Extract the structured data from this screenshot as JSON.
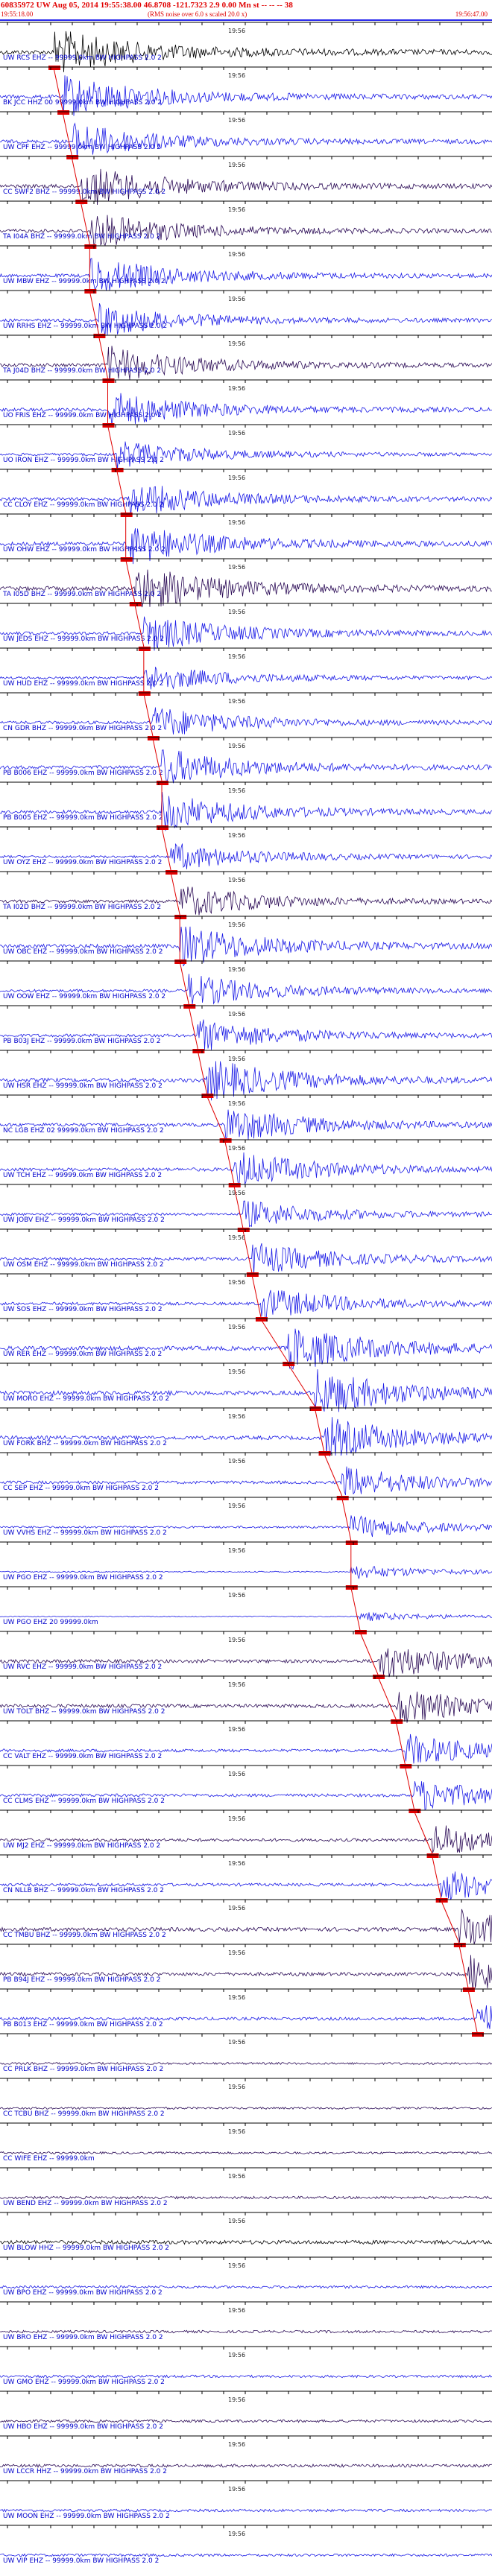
{
  "header": {
    "title": "60835972 UW Aug 05, 2014 19:55:38.00    46.8708 -121.7323  2.9 0.00 Mn st -- -- -- 38",
    "start_time": "19:55:18.00",
    "rms_note": "(RMS noise over 6.0 s scaled 20.0 x)",
    "end_time": "19:56:47.00"
  },
  "colors": {
    "title": "#e00000",
    "trace_blue": "#1a1ae6",
    "trace_dark": "#2a0a55",
    "trace_black": "#000000",
    "pick_red": "#e00000",
    "tick": "#000000"
  },
  "chart_data": {
    "type": "line",
    "title": "60835972 UW Aug 05, 2014 19:55:38.00    46.8708 -121.7323  2.9 0.00 Mn st -- -- -- 38",
    "time_range": [
      "19:55:18.00",
      "19:56:47.00"
    ],
    "tick_label": "19:56",
    "series": [
      {
        "name": "UW RCS EHZ -- 99999.0km BW HIGHPASS 2.0 2",
        "pick": 0.0,
        "amp": 1.0,
        "color": "black"
      },
      {
        "name": "BK JCC HHZ 00 99999.0km BW HIGHPASS 2.0 2",
        "pick": 0.01,
        "amp": 0.9,
        "color": "blue"
      },
      {
        "name": "UW CPF EHZ -- 99999.0km BW HIGHPASS 2.0 2",
        "pick": 0.02,
        "amp": 0.8,
        "color": "blue"
      },
      {
        "name": "CC SWF2 BHZ -- 99999.0km BW HIGHPASS 2.0 2",
        "pick": 0.03,
        "amp": 0.9,
        "color": "dark"
      },
      {
        "name": "TA I04A BHZ -- 99999.0km BW HIGHPASS 2.0 2",
        "pick": 0.04,
        "amp": 0.8,
        "color": "dark"
      },
      {
        "name": "UW MBW EHZ -- 99999.0km BW HIGHPASS 2.0 2",
        "pick": 0.04,
        "amp": 0.8,
        "color": "blue"
      },
      {
        "name": "UW RRHS EHZ -- 99999.0km BW HIGHPASS 2.0 2",
        "pick": 0.05,
        "amp": 0.7,
        "color": "blue"
      },
      {
        "name": "TA J04D BHZ -- 99999.0km BW HIGHPASS 2.0 2",
        "pick": 0.06,
        "amp": 0.8,
        "color": "dark"
      },
      {
        "name": "UO FRIS EHZ -- 99999.0km BW HIGHPASS 2.0 2",
        "pick": 0.06,
        "amp": 0.8,
        "color": "blue"
      },
      {
        "name": "UO IRON EHZ -- 99999.0km BW HIGHPASS 2.0 2",
        "pick": 0.07,
        "amp": 0.6,
        "color": "blue"
      },
      {
        "name": "CC CLOY EHZ -- 99999.0km BW HIGHPASS 2.0 2",
        "pick": 0.08,
        "amp": 0.8,
        "color": "blue"
      },
      {
        "name": "UW OHW EHZ -- 99999.0km BW HIGHPASS 2.0 2",
        "pick": 0.08,
        "amp": 0.9,
        "color": "blue"
      },
      {
        "name": "TA I05D BHZ -- 99999.0km BW HIGHPASS 2.0 2",
        "pick": 0.09,
        "amp": 1.0,
        "color": "dark"
      },
      {
        "name": "UW JEDS EHZ -- 99999.0km BW HIGHPASS 2.0 2",
        "pick": 0.1,
        "amp": 0.8,
        "color": "blue"
      },
      {
        "name": "UW HUD EHZ -- 99999.0km BW HIGHPASS 2.0 2",
        "pick": 0.1,
        "amp": 0.6,
        "color": "blue"
      },
      {
        "name": "CN GDR BHZ -- 99999.0km BW HIGHPASS 2.0 2",
        "pick": 0.11,
        "amp": 0.7,
        "color": "blue"
      },
      {
        "name": "PB B006 EHZ -- 99999.0km BW HIGHPASS 2.0 2",
        "pick": 0.12,
        "amp": 0.8,
        "color": "blue"
      },
      {
        "name": "PB B005 EHZ -- 99999.0km BW HIGHPASS 2.0 2",
        "pick": 0.12,
        "amp": 0.8,
        "color": "blue"
      },
      {
        "name": "UW OYZ EHZ -- 99999.0km BW HIGHPASS 2.0 2",
        "pick": 0.13,
        "amp": 0.6,
        "color": "blue"
      },
      {
        "name": "TA I02D BHZ -- 99999.0km BW HIGHPASS 2.0 2",
        "pick": 0.14,
        "amp": 0.7,
        "color": "dark"
      },
      {
        "name": "UW OBC EHZ -- 99999.0km BW HIGHPASS 2.0 2",
        "pick": 0.14,
        "amp": 0.9,
        "color": "blue"
      },
      {
        "name": "UW OOW EHZ -- 99999.0km BW HIGHPASS 2.0 2",
        "pick": 0.15,
        "amp": 0.7,
        "color": "blue"
      },
      {
        "name": "PB B03J EHZ -- 99999.0km BW HIGHPASS 2.0 2",
        "pick": 0.16,
        "amp": 0.7,
        "color": "blue"
      },
      {
        "name": "UW HSR EHZ -- 99999.0km BW HIGHPASS 2.0 2",
        "pick": 0.17,
        "amp": 0.9,
        "color": "blue"
      },
      {
        "name": "NC LGB EHZ 02 99999.0km BW HIGHPASS 2.0 2",
        "pick": 0.19,
        "amp": 0.8,
        "color": "blue"
      },
      {
        "name": "UW TCH EHZ -- 99999.0km BW HIGHPASS 2.0 2",
        "pick": 0.2,
        "amp": 0.8,
        "color": "blue"
      },
      {
        "name": "UW JOBV EHZ -- 99999.0km BW HIGHPASS 2.0 2",
        "pick": 0.21,
        "amp": 0.6,
        "color": "blue"
      },
      {
        "name": "UW OSM EHZ -- 99999.0km BW HIGHPASS 2.0 2",
        "pick": 0.22,
        "amp": 0.7,
        "color": "blue"
      },
      {
        "name": "UW SOS EHZ -- 99999.0km BW HIGHPASS 2.0 2",
        "pick": 0.23,
        "amp": 0.7,
        "color": "blue"
      },
      {
        "name": "UW RER EHZ -- 99999.0km BW HIGHPASS 2.0 2",
        "pick": 0.26,
        "amp": 1.0,
        "color": "blue"
      },
      {
        "name": "UW MORO EHZ -- 99999.0km BW HIGHPASS 2.0 2",
        "pick": 0.29,
        "amp": 1.0,
        "color": "blue"
      },
      {
        "name": "UW FORK BHZ -- 99999.0km BW HIGHPASS 2.0 2",
        "pick": 0.3,
        "amp": 0.9,
        "color": "blue"
      },
      {
        "name": "CC SEP EHZ -- 99999.0km BW HIGHPASS 2.0 2",
        "pick": 0.32,
        "amp": 0.7,
        "color": "blue"
      },
      {
        "name": "UW VVHS EHZ -- 99999.0km BW HIGHPASS 2.0 2",
        "pick": 0.33,
        "amp": 0.5,
        "color": "blue"
      },
      {
        "name": "UW PGO EHZ -- 99999.0km BW HIGHPASS 2.0 2",
        "pick": 0.33,
        "amp": 0.3,
        "color": "blue"
      },
      {
        "name": "UW PGO EHZ 20 99999.0km",
        "pick": 0.34,
        "amp": 0.2,
        "color": "blue"
      },
      {
        "name": "UW RVC EHZ -- 99999.0km BW HIGHPASS 2.0 2",
        "pick": 0.36,
        "amp": 0.8,
        "color": "dark"
      },
      {
        "name": "UW TOLT BHZ -- 99999.0km BW HIGHPASS 2.0 2",
        "pick": 0.38,
        "amp": 0.8,
        "color": "dark"
      },
      {
        "name": "CC VALT EHZ -- 99999.0km BW HIGHPASS 2.0 2",
        "pick": 0.39,
        "amp": 0.7,
        "color": "blue"
      },
      {
        "name": "CC CLMS EHZ -- 99999.0km BW HIGHPASS 2.0 2",
        "pick": 0.4,
        "amp": 0.7,
        "color": "blue"
      },
      {
        "name": "UW MJ2 EHZ -- 99999.0km BW HIGHPASS 2.0 2",
        "pick": 0.42,
        "amp": 0.7,
        "color": "dark"
      },
      {
        "name": "CN NLLB BHZ -- 99999.0km BW HIGHPASS 2.0 2",
        "pick": 0.43,
        "amp": 0.7,
        "color": "blue"
      },
      {
        "name": "CC TMBU BHZ -- 99999.0km BW HIGHPASS 2.0 2",
        "pick": 0.45,
        "amp": 0.9,
        "color": "dark"
      },
      {
        "name": "PB B94J EHZ -- 99999.0km BW HIGHPASS 2.0 2",
        "pick": 0.46,
        "amp": 0.8,
        "color": "dark"
      },
      {
        "name": "PB B013 EHZ -- 99999.0km BW HIGHPASS 2.0 2",
        "pick": 0.47,
        "amp": 0.7,
        "color": "blue"
      },
      {
        "name": "CC PRLK BHZ -- 99999.0km BW HIGHPASS 2.0 2",
        "pick": null,
        "amp": 0.5,
        "color": "dark"
      },
      {
        "name": "CC TCBU BHZ -- 99999.0km BW HIGHPASS 2.0 2",
        "pick": null,
        "amp": 0.5,
        "color": "dark"
      },
      {
        "name": "CC WIFE EHZ -- 99999.0km",
        "pick": null,
        "amp": 0.5,
        "color": "dark"
      },
      {
        "name": "UW BEND EHZ -- 99999.0km BW HIGHPASS 2.0 2",
        "pick": null,
        "amp": 0.6,
        "color": "dark"
      },
      {
        "name": "UW BLOW HHZ -- 99999.0km BW HIGHPASS 2.0 2",
        "pick": null,
        "amp": 0.9,
        "color": "black"
      },
      {
        "name": "UW BPO EHZ -- 99999.0km BW HIGHPASS 2.0 2",
        "pick": null,
        "amp": 0.6,
        "color": "blue"
      },
      {
        "name": "UW BRO EHZ -- 99999.0km BW HIGHPASS 2.0 2",
        "pick": null,
        "amp": 0.6,
        "color": "dark"
      },
      {
        "name": "UW GMO EHZ -- 99999.0km BW HIGHPASS 2.0 2",
        "pick": null,
        "amp": 0.6,
        "color": "blue"
      },
      {
        "name": "UW HBO EHZ -- 99999.0km BW HIGHPASS 2.0 2",
        "pick": null,
        "amp": 0.6,
        "color": "dark"
      },
      {
        "name": "UW LCCR HHZ -- 99999.0km BW HIGHPASS 2.0 2",
        "pick": null,
        "amp": 0.7,
        "color": "dark"
      },
      {
        "name": "UW MOON EHZ -- 99999.0km BW HIGHPASS 2.0 2",
        "pick": null,
        "amp": 0.6,
        "color": "blue"
      },
      {
        "name": "UW VIP EHZ -- 99999.0km BW HIGHPASS 2.0 2",
        "pick": null,
        "amp": 0.6,
        "color": "blue"
      }
    ]
  }
}
